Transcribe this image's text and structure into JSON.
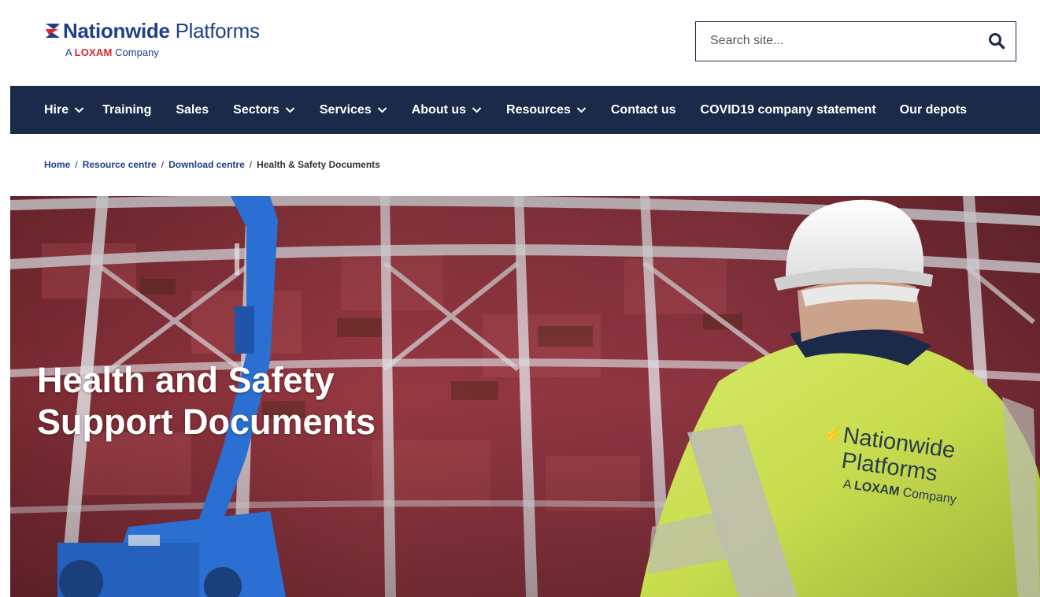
{
  "brand": {
    "name_bold": "Nationwide",
    "name_light": " Platforms",
    "sub_prefix": "A",
    "sub_brand": "LOXAM",
    "sub_suffix": "Company",
    "primary_color": "#1f3f8a",
    "accent_color": "#d9232d"
  },
  "search": {
    "placeholder": "Search site...",
    "icon": "search-icon"
  },
  "nav": {
    "background": "#1c2a4a",
    "items": [
      {
        "label": "Hire",
        "has_dropdown": true
      },
      {
        "label": "Training",
        "has_dropdown": false
      },
      {
        "label": "Sales",
        "has_dropdown": false
      },
      {
        "label": "Sectors",
        "has_dropdown": true
      },
      {
        "label": "Services",
        "has_dropdown": true
      },
      {
        "label": "About us",
        "has_dropdown": true
      },
      {
        "label": "Resources",
        "has_dropdown": true
      },
      {
        "label": "Contact us",
        "has_dropdown": false
      },
      {
        "label": "COVID19 company statement",
        "has_dropdown": false
      },
      {
        "label": "Our depots",
        "has_dropdown": false
      }
    ]
  },
  "breadcrumb": {
    "items": [
      "Home",
      "Resource centre",
      "Download centre"
    ],
    "separator": "/",
    "current": "Health & Safety Documents"
  },
  "hero": {
    "title_line1": "Health and Safety",
    "title_line2": "Support Documents",
    "vest_line1": "Nationwide",
    "vest_line2": "Platforms",
    "vest_prefix": "A",
    "vest_brand": "LOXAM",
    "vest_suffix": "Company"
  }
}
